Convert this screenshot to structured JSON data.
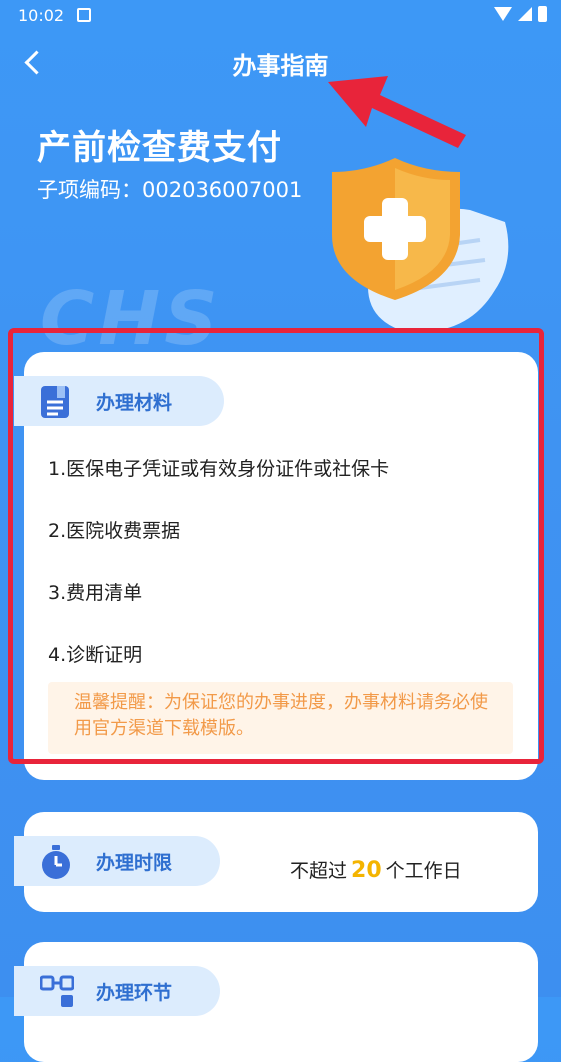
{
  "status_bar": {
    "time": "10:02"
  },
  "header": {
    "title": "办事指南"
  },
  "hero": {
    "title": "产前检查费支付",
    "subtitle_label": "子项编码：",
    "subtitle_code": "002036007001",
    "watermark": "CHS"
  },
  "materials": {
    "section_label": "办理材料",
    "items": [
      "1.医保电子凭证或有效身份证件或社保卡",
      "2.医院收费票据",
      "3.费用清单",
      "4.诊断证明"
    ],
    "notice": "温馨提醒：为保证您的办事进度，办事材料请务必使用官方渠道下载模版。"
  },
  "time_limit": {
    "section_label": "办理时限",
    "prefix": "不超过",
    "days": "20",
    "suffix": "个工作日"
  },
  "steps": {
    "section_label": "办理环节"
  },
  "colors": {
    "background": "#3d98f6",
    "accent_blue": "#2f6fd0",
    "notice_text": "#f29a49",
    "highlight": "#f4b400",
    "annotation_red": "#e8243a"
  },
  "icons": [
    "back-arrow-icon",
    "document-icon",
    "stopwatch-icon",
    "flow-nodes-icon",
    "shield-plus-icon"
  ]
}
